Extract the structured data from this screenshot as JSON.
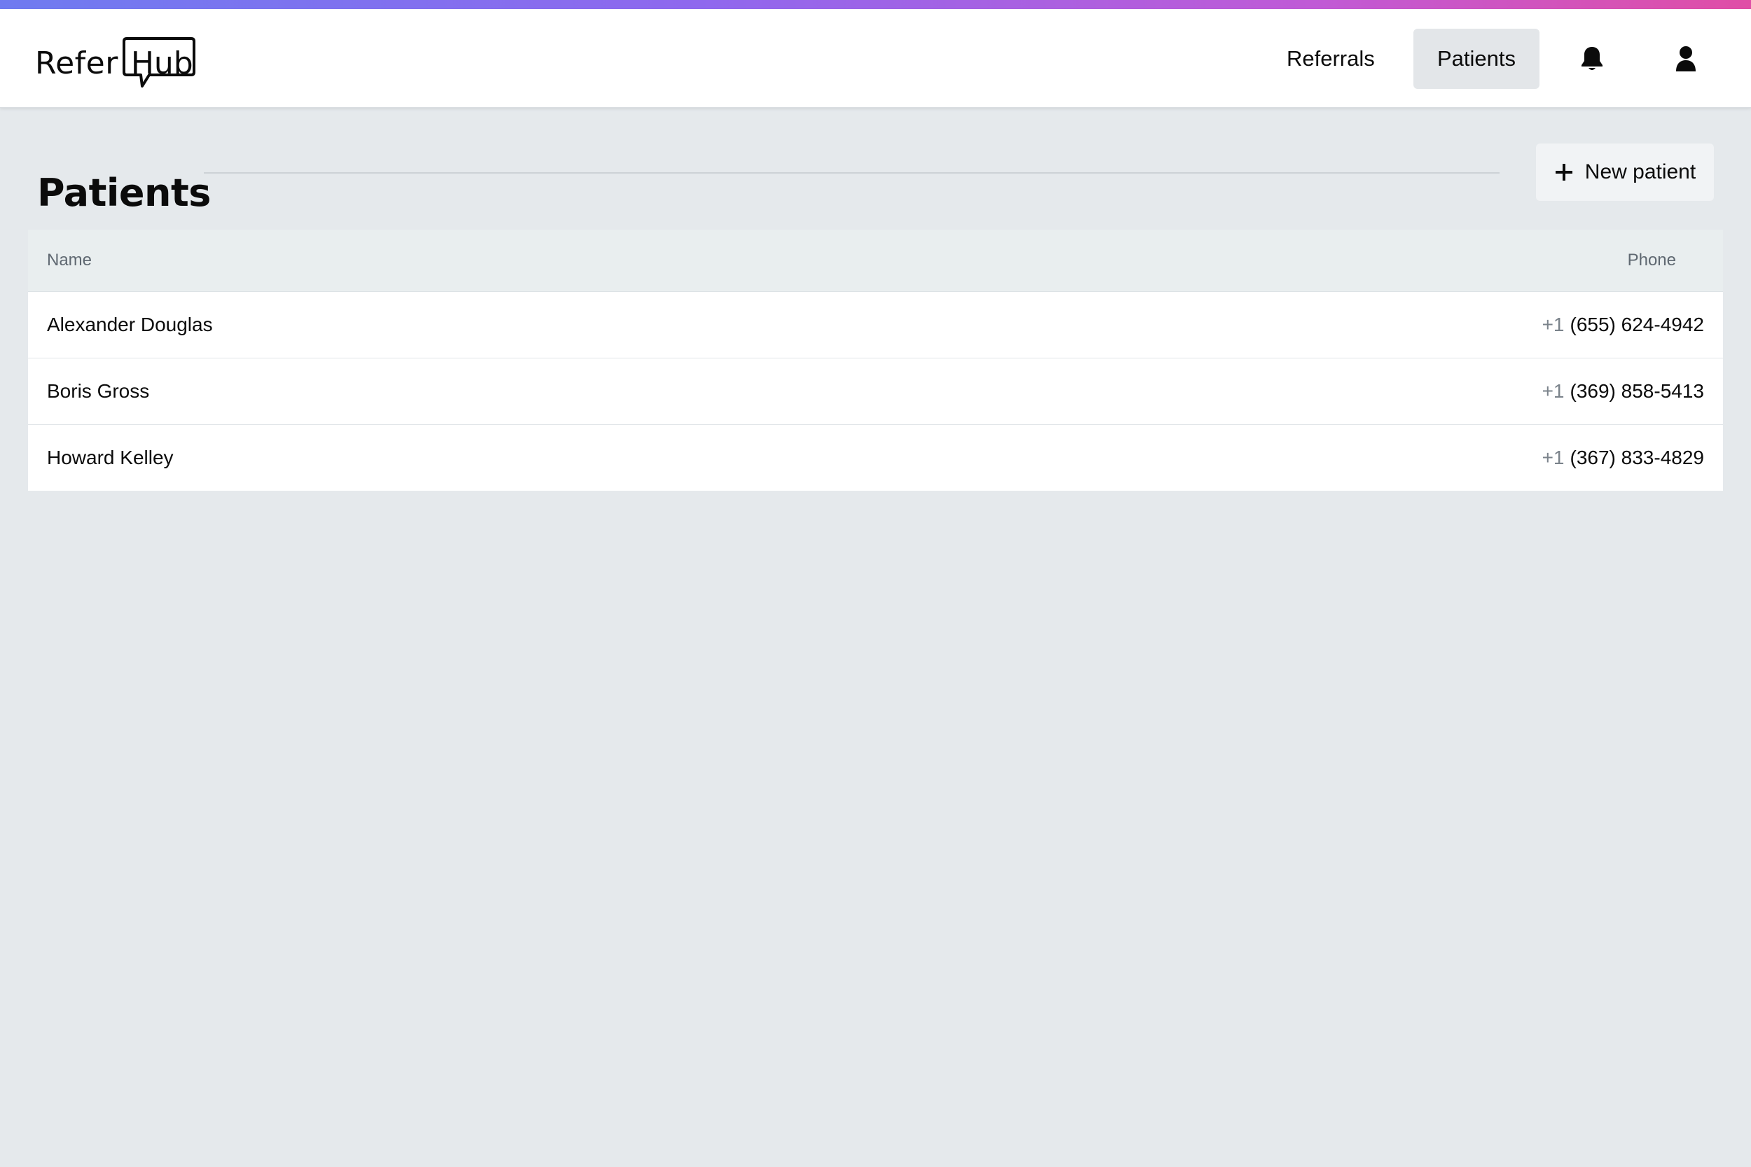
{
  "app": {
    "logo_part1": "Refer",
    "logo_part2": "Hub"
  },
  "nav": {
    "items": [
      {
        "label": "Referrals",
        "active": false
      },
      {
        "label": "Patients",
        "active": true
      }
    ],
    "icons": [
      "bell-icon",
      "user-icon"
    ]
  },
  "page": {
    "title": "Patients",
    "new_button_label": "New patient"
  },
  "table": {
    "columns": [
      "Name",
      "Phone"
    ],
    "rows": [
      {
        "name": "Alexander Douglas",
        "country_code": "+1",
        "phone": "(655) 624-4942"
      },
      {
        "name": "Boris Gross",
        "country_code": "+1",
        "phone": "(369) 858-5413"
      },
      {
        "name": "Howard Kelley",
        "country_code": "+1",
        "phone": "(367) 833-4829"
      }
    ]
  },
  "colors": {
    "background": "#e5e9ec",
    "header_bg": "#ffffff",
    "active_nav_bg": "#e3e6e9",
    "gradient_start": "#6f7bf0",
    "gradient_end": "#e04ea6"
  }
}
